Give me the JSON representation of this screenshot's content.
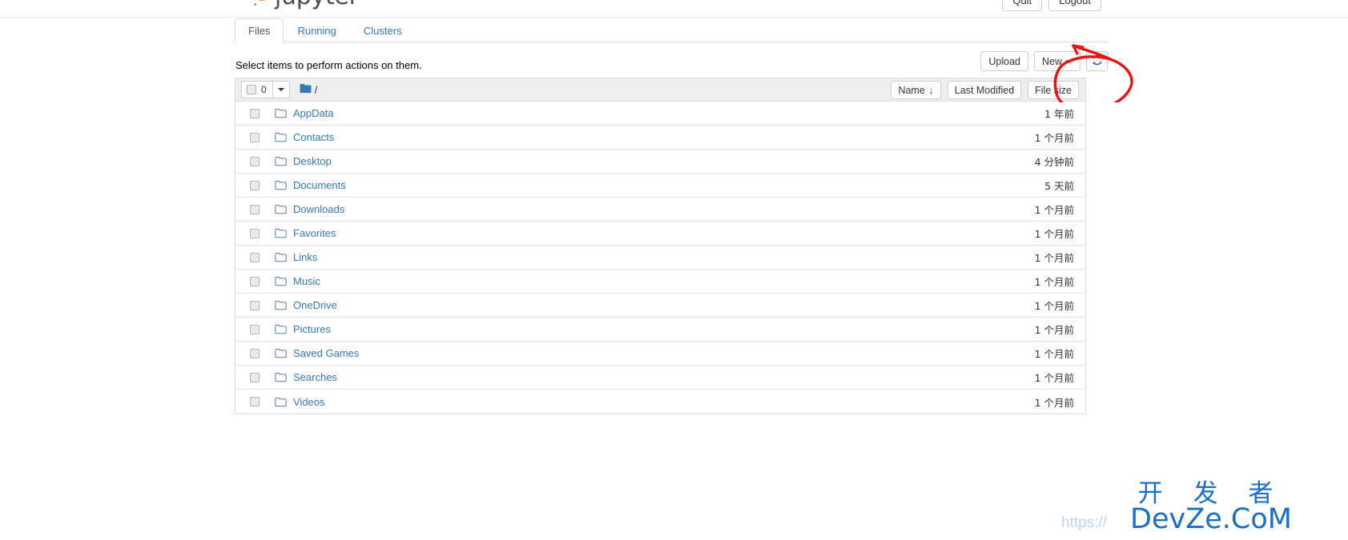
{
  "header": {
    "brand": "jupyter",
    "logo_icon": "jupyter-logo-icon",
    "buttons": [
      {
        "label": "Quit",
        "name": "quit-button"
      },
      {
        "label": "Logout",
        "name": "logout-button"
      }
    ]
  },
  "tabs": [
    {
      "label": "Files",
      "active": true
    },
    {
      "label": "Running",
      "active": false
    },
    {
      "label": "Clusters",
      "active": false
    }
  ],
  "toolbar": {
    "hint": "Select items to perform actions on them.",
    "upload_label": "Upload",
    "new_label": "New",
    "refresh_icon": "refresh-icon"
  },
  "list_header": {
    "selected_count": "0",
    "select_all_checkbox": "select-all-checkbox",
    "dropdown_icon": "chevron-down-icon",
    "breadcrumb_root": "/",
    "folder_icon": "folder-filled-icon",
    "sort": {
      "name_label": "Name",
      "name_arrow": "↓",
      "modified_label": "Last Modified",
      "size_label": "File size"
    }
  },
  "files": [
    {
      "name": "AppData",
      "modified": "1 年前",
      "size": ""
    },
    {
      "name": "Contacts",
      "modified": "1 个月前",
      "size": ""
    },
    {
      "name": "Desktop",
      "modified": "4 分钟前",
      "size": ""
    },
    {
      "name": "Documents",
      "modified": "5 天前",
      "size": ""
    },
    {
      "name": "Downloads",
      "modified": "1 个月前",
      "size": ""
    },
    {
      "name": "Favorites",
      "modified": "1 个月前",
      "size": ""
    },
    {
      "name": "Links",
      "modified": "1 个月前",
      "size": ""
    },
    {
      "name": "Music",
      "modified": "1 个月前",
      "size": ""
    },
    {
      "name": "OneDrive",
      "modified": "1 个月前",
      "size": ""
    },
    {
      "name": "Pictures",
      "modified": "1 个月前",
      "size": ""
    },
    {
      "name": "Saved Games",
      "modified": "1 个月前",
      "size": ""
    },
    {
      "name": "Searches",
      "modified": "1 个月前",
      "size": ""
    },
    {
      "name": "Videos",
      "modified": "1 个月前",
      "size": ""
    }
  ],
  "annotation": {
    "type": "hand-drawn-circle-with-arrow",
    "color": "#ee1111",
    "target": "Upload"
  },
  "watermark": {
    "cn": "开 发 者",
    "en": "DevZe.CoM",
    "url": "https://",
    "color": "#1a6fc4"
  }
}
